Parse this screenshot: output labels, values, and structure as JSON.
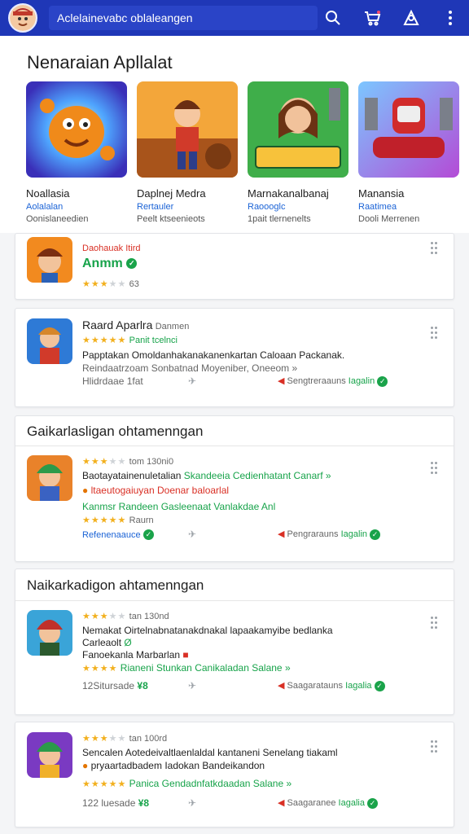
{
  "header": {
    "search_text": "Aclelainevabc oblaleangen",
    "avatar_icon": "game-character-icon",
    "icons": [
      "search-icon",
      "cart-icon",
      "account-icon",
      "more-icon"
    ],
    "bar_color": "#1f37b7"
  },
  "featured": {
    "title": "Nenaraian Apllalat",
    "apps": [
      {
        "name": "Noallasia",
        "dev": "Aolalalan",
        "meta": "Oonislaneedien"
      },
      {
        "name": "Daplnej Medra",
        "dev": "Rertauler",
        "meta": "Peelt ktseenieots"
      },
      {
        "name": "Marnakanalbanaj",
        "dev": "Raoooglc",
        "meta": "1pait tlernenelts"
      },
      {
        "name": "Manansia",
        "dev": "Raatimea",
        "meta": "Dooli Merrenen"
      }
    ]
  },
  "cards": {
    "c1": {
      "top": "Daohauak Itird",
      "name": "Anmm",
      "stars": "★★★",
      "stars_off": "★★",
      "count": "63"
    },
    "c2": {
      "name": "Raard Aparlra",
      "tag": "Danmen",
      "stars": "★★★★★",
      "stars_note": "Panit tcelnci",
      "desc": "Papptakan Omoldanhakanakanenkartan Caloaan Packanak.",
      "sub": "Reindaatrzoam Sonbatnad Moyeniber, Oneeom »",
      "date": "Hlidrdaae 1fat",
      "right_label": "Sengtreraauns",
      "right_state": "Iagalin"
    },
    "s1": {
      "title": "Gaikarlasligan ohtamenngan"
    },
    "c3": {
      "stars": "★★★",
      "stars_off": "★★",
      "meta": "tom 130ni0",
      "l1a": "Baotayatainenuletalian",
      "l1b": "Skandeeia Cedienhatant Canarf »",
      "l2": "ltaeutogaiuyan Doenar baloarlal",
      "l3": "Kanmsr Randeen Gasleenaat Vanlakdae Anl",
      "stars2": "★★★★★",
      "l4": "Raurn",
      "l5": "Refenenaauce",
      "right_label": "Pengrarauns",
      "right_state": "Iagalin"
    },
    "s2": {
      "title": "Naikarkadigon ahtamenngan"
    },
    "c4": {
      "stars": "★★★",
      "stars_off": "★★",
      "meta": "tan 130nd",
      "l1": "Nemakat Oirtelnabnatanakdnakal lapaakamyibe bedlanka",
      "l2": "Carleaolt",
      "l3": "Fanoekanla Marbarlan",
      "stars2": "★★★★",
      "l4": "Rianeni Stunkan Canikaladan Salane »",
      "date": "12Sitursade",
      "right_label": "Saagaratauns",
      "right_state": "Iagalia"
    },
    "c5": {
      "stars": "★★★",
      "stars_off": "★★",
      "meta": "tan 100rd",
      "l1": "Sencalen Aotedeivaltlaenlaldal kantaneni Senelang tiakaml",
      "l2": "pryaartadbadem Iadokan Bandeikandon",
      "stars2": "★★★★★",
      "l4": "Panica Gendadnfatkdaadan Salane »",
      "date": "122 luesade",
      "right_label": "Saagaranee",
      "right_state": "Iagalia"
    }
  }
}
